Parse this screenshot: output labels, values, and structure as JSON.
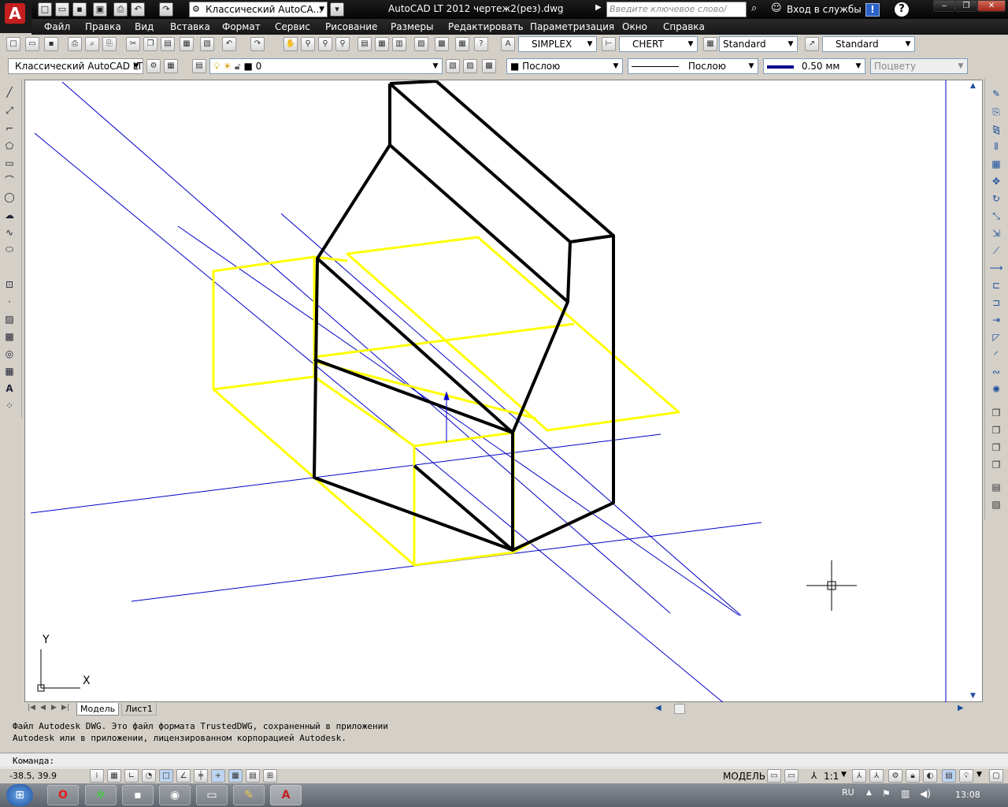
{
  "title_bar": {
    "workspace": "Классический AutoCA...",
    "window_title": "AutoCAD LT 2012    чертеж2(рез).dwg",
    "search_placeholder": "Введите ключевое слово/фразу",
    "login": "Вход в службы"
  },
  "menu": [
    "Файл",
    "Правка",
    "Вид",
    "Вставка",
    "Формат",
    "Сервис",
    "Рисование",
    "Размеры",
    "Редактировать",
    "Параметризация",
    "Окно",
    "Справка"
  ],
  "styles_toolbar": {
    "text_style": "SIMPLEX",
    "dim_style": "CHERT",
    "table_style": "Standard",
    "mleader_style": "Standard"
  },
  "layers_toolbar": {
    "workspace": "Классический AutoCAD LT",
    "layer": "0",
    "color": "Послою",
    "linetype": "Послою",
    "lineweight": "0.50 мм",
    "plotstyle": "Поцвету"
  },
  "tabs": {
    "model": "Модель",
    "layout1": "Лист1"
  },
  "ucs": {
    "y_label": "Y",
    "x_label": "X"
  },
  "command": {
    "line1": "Файл Autodesk DWG. Это файл формата TrustedDWG, сохраненный в приложении",
    "line2": "Autodesk или в приложении, лицензированном корпорацией Autodesk.",
    "prompt": "Команда:"
  },
  "status": {
    "coords": "-38.5,  39.9",
    "model": "МОДЕЛЬ",
    "scale": "1:1"
  },
  "taskbar": {
    "lang": "RU",
    "time": "13:08"
  }
}
